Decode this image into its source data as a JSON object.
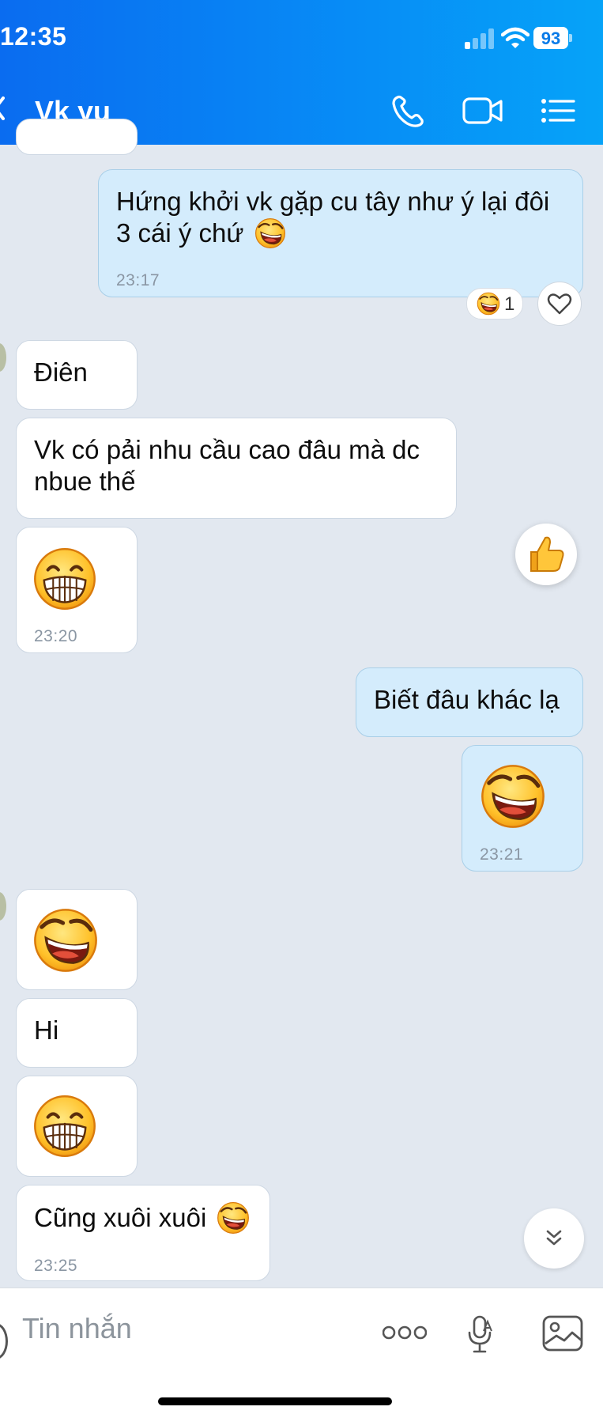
{
  "status_bar": {
    "time": "12:35",
    "battery": "93"
  },
  "header": {
    "contact_name": "Vk yu"
  },
  "messages": [
    {
      "text": "Hứng khởi vk gặp cu tây như ý lại đôi 3 cái ý chứ",
      "time": "23:17",
      "reaction_count": "1"
    },
    {
      "text": "Điên"
    },
    {
      "text": "Vk có pải nhu cầu cao đâu mà dc nbue thế"
    },
    {
      "time": "23:20"
    },
    {
      "text": "Biết đâu khác lạ"
    },
    {
      "time": "23:21"
    },
    {
      "text": "Hi"
    },
    {
      "text": "Cũng xuôi xuôi",
      "time": "23:25"
    }
  ],
  "composer": {
    "placeholder": "Tin nhắn"
  },
  "colors": {
    "header_blue": "#078df6",
    "outgoing_bubble": "#d4ecfc",
    "chat_background": "#e2e8f0"
  },
  "icons": [
    "back-chevron-icon",
    "phone-icon",
    "video-icon",
    "menu-list-icon",
    "heart-icon",
    "thumbs-up-icon",
    "chevron-double-down-icon",
    "more-icon",
    "mic-icon",
    "image-icon",
    "laughing-emoji-icon",
    "grinning-emoji-icon"
  ]
}
